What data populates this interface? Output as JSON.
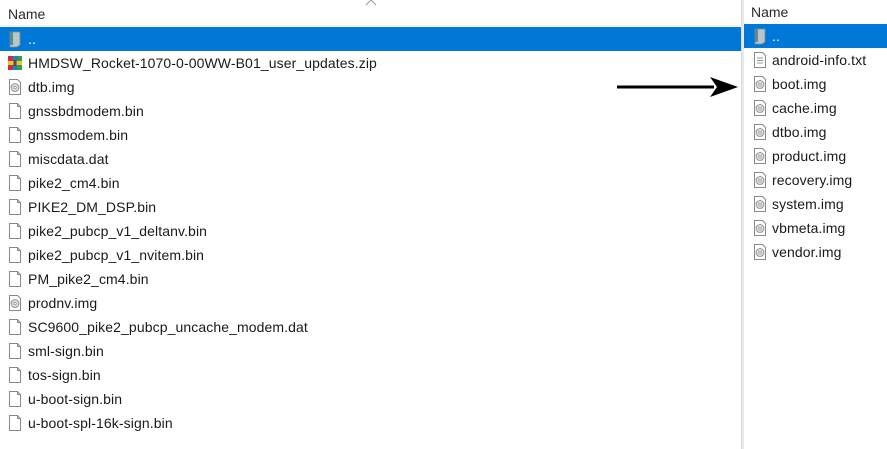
{
  "left_pane": {
    "column_header": "Name",
    "items": [
      {
        "name": "..",
        "icon": "parent-folder-icon",
        "selected": true
      },
      {
        "name": "HMDSW_Rocket-1070-0-00WW-B01_user_updates.zip",
        "icon": "zip-archive-icon"
      },
      {
        "name": "dtb.img",
        "icon": "disc-image-file-icon"
      },
      {
        "name": "gnssbdmodem.bin",
        "icon": "file-icon"
      },
      {
        "name": "gnssmodem.bin",
        "icon": "file-icon"
      },
      {
        "name": "miscdata.dat",
        "icon": "file-icon"
      },
      {
        "name": "pike2_cm4.bin",
        "icon": "file-icon"
      },
      {
        "name": "PIKE2_DM_DSP.bin",
        "icon": "file-icon"
      },
      {
        "name": "pike2_pubcp_v1_deltanv.bin",
        "icon": "file-icon"
      },
      {
        "name": "pike2_pubcp_v1_nvitem.bin",
        "icon": "file-icon"
      },
      {
        "name": "PM_pike2_cm4.bin",
        "icon": "file-icon"
      },
      {
        "name": "prodnv.img",
        "icon": "disc-image-file-icon"
      },
      {
        "name": "SC9600_pike2_pubcp_uncache_modem.dat",
        "icon": "file-icon"
      },
      {
        "name": "sml-sign.bin",
        "icon": "file-icon"
      },
      {
        "name": "tos-sign.bin",
        "icon": "file-icon"
      },
      {
        "name": "u-boot-sign.bin",
        "icon": "file-icon"
      },
      {
        "name": "u-boot-spl-16k-sign.bin",
        "icon": "file-icon"
      }
    ]
  },
  "right_pane": {
    "column_header": "Name",
    "items": [
      {
        "name": "..",
        "icon": "parent-folder-icon",
        "selected": true
      },
      {
        "name": "android-info.txt",
        "icon": "text-file-icon"
      },
      {
        "name": "boot.img",
        "icon": "disc-image-file-icon"
      },
      {
        "name": "cache.img",
        "icon": "disc-image-file-icon"
      },
      {
        "name": "dtbo.img",
        "icon": "disc-image-file-icon"
      },
      {
        "name": "product.img",
        "icon": "disc-image-file-icon"
      },
      {
        "name": "recovery.img",
        "icon": "disc-image-file-icon"
      },
      {
        "name": "system.img",
        "icon": "disc-image-file-icon"
      },
      {
        "name": "vbmeta.img",
        "icon": "disc-image-file-icon"
      },
      {
        "name": "vendor.img",
        "icon": "disc-image-file-icon"
      }
    ]
  },
  "colors": {
    "selection": "#0078d7",
    "icon_outline": "#7a7a7a",
    "arrow": "#000000"
  }
}
